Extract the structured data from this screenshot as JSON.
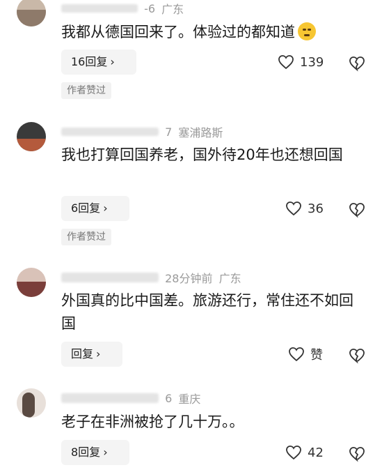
{
  "comments": [
    {
      "meta_suffix": "-6",
      "location": "广东",
      "text": "我都从德国回来了。体验过的都知道",
      "reply_label": "16回复",
      "likes": "139",
      "author_tag": "作者赞过"
    },
    {
      "meta_suffix": "7",
      "location": "塞浦路斯",
      "text": "我也打算回国养老，国外待20年也还想回国",
      "reply_label": "6回复",
      "likes": "36",
      "author_tag": "作者赞过"
    },
    {
      "meta_suffix": "28分钟前",
      "location": "广东",
      "text": "外国真的比中国差。旅游还行，常住还不如回国",
      "reply_label": "回复",
      "likes": "赞"
    },
    {
      "meta_suffix": "6",
      "location": "重庆",
      "text": "老子在非洲被抢了几十万。。",
      "reply_label": "8回复",
      "likes": "42"
    }
  ],
  "icons": {
    "chevron": "chevron-right-icon",
    "like": "heart-icon",
    "dislike": "broken-heart-icon"
  }
}
